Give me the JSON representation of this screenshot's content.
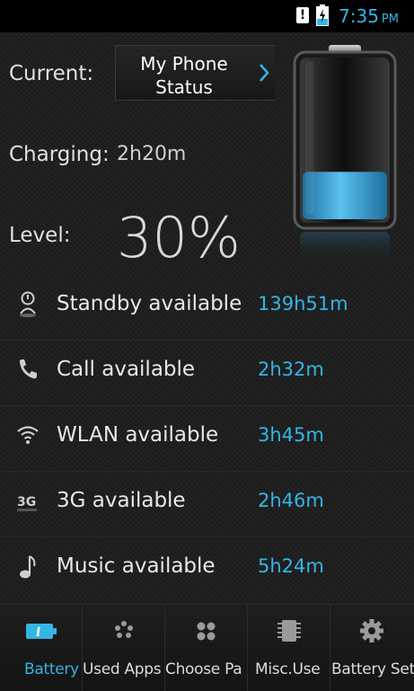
{
  "status_bar": {
    "time": "7:35",
    "ampm": "PM",
    "icons": [
      "alert-icon",
      "battery-charging-icon"
    ]
  },
  "summary": {
    "current_label": "Current:",
    "status_button_line1": "My Phone",
    "status_button_line2": "Status",
    "charging_label": "Charging:",
    "charging_value": "2h20m",
    "level_label": "Level:",
    "level_value": "30%",
    "level_fraction": 0.3
  },
  "rows": [
    {
      "icon": "standby-icon",
      "label": "Standby available",
      "value": "139h51m"
    },
    {
      "icon": "phone-icon",
      "label": "Call available",
      "value": "2h32m"
    },
    {
      "icon": "wifi-icon",
      "label": "WLAN available",
      "value": "3h45m"
    },
    {
      "icon": "3g-icon",
      "label": "3G available",
      "value": "2h46m"
    },
    {
      "icon": "music-note-icon",
      "label": "Music available",
      "value": "5h24m"
    }
  ],
  "tabs": [
    {
      "icon": "battery-info-icon",
      "label": "Battery",
      "active": true
    },
    {
      "icon": "used-apps-icon",
      "label": "Used Apps",
      "active": false
    },
    {
      "icon": "choose-pattern-icon",
      "label": "Choose Pa",
      "active": false
    },
    {
      "icon": "chip-icon",
      "label": "Misc.Use",
      "active": false
    },
    {
      "icon": "gear-icon",
      "label": "Battery Set",
      "active": false
    }
  ],
  "colors": {
    "accent": "#33b5e5",
    "background": "#1b1b1b",
    "status_bar": "#000000"
  },
  "icon_text": {
    "alert": "!",
    "3g": "3G"
  }
}
